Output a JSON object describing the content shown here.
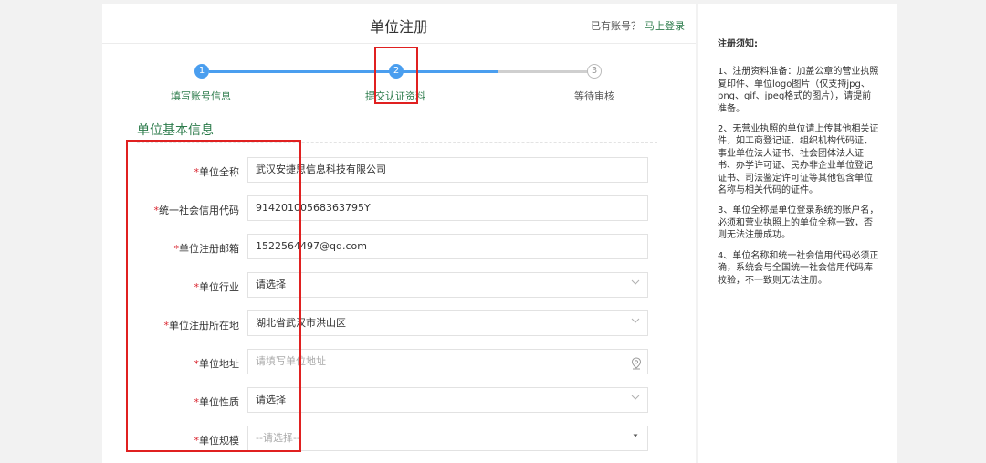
{
  "header": {
    "title": "单位注册",
    "have_account": "已有账号？",
    "login_link": "马上登录"
  },
  "steps": [
    {
      "number": "1",
      "label": "填写账号信息",
      "state": "done"
    },
    {
      "number": "2",
      "label": "提交认证资料",
      "state": "active"
    },
    {
      "number": "3",
      "label": "等待审核",
      "state": "pending"
    }
  ],
  "section": {
    "title": "单位基本信息"
  },
  "required_mark": "*",
  "fields": [
    {
      "label": "单位全称",
      "value": "武汉安捷思信息科技有限公司",
      "type": "text"
    },
    {
      "label": "统一社会信用代码",
      "value": "91420100568363795Y",
      "type": "text"
    },
    {
      "label": "单位注册邮箱",
      "value": "1522564497@qq.com",
      "type": "text"
    },
    {
      "label": "单位行业",
      "value": "请选择",
      "type": "select"
    },
    {
      "label": "单位注册所在地",
      "value": "湖北省武汉市洪山区",
      "type": "select"
    },
    {
      "label": "单位地址",
      "placeholder": "请填写单位地址",
      "type": "address"
    },
    {
      "label": "单位性质",
      "value": "请选择",
      "type": "select"
    },
    {
      "label": "单位规模",
      "value": "--请选择--",
      "type": "native-select"
    }
  ],
  "notice": {
    "title": "注册须知:",
    "items": [
      "1、注册资料准备：加盖公章的营业执照复印件、单位logo图片（仅支持jpg、png、gif、jpeg格式的图片），请提前准备。",
      "2、无营业执照的单位请上传其他相关证件，如工商登记证、组织机构代码证、事业单位法人证书、社会团体法人证书、办学许可证、民办非企业单位登记证书、司法鉴定许可证等其他包含单位名称与相关代码的证件。",
      "3、单位全称是单位登录系统的账户名，必须和营业执照上的单位全称一致，否则无法注册成功。",
      "4、单位名称和统一社会信用代码必须正确，系统会与全国统一社会信用代码库校验，不一致则无法注册。"
    ]
  },
  "colors": {
    "accent_green": "#2c7b4b",
    "step_blue": "#4a9eef",
    "required_red": "#d9232d",
    "annotation_red": "#e02020"
  }
}
